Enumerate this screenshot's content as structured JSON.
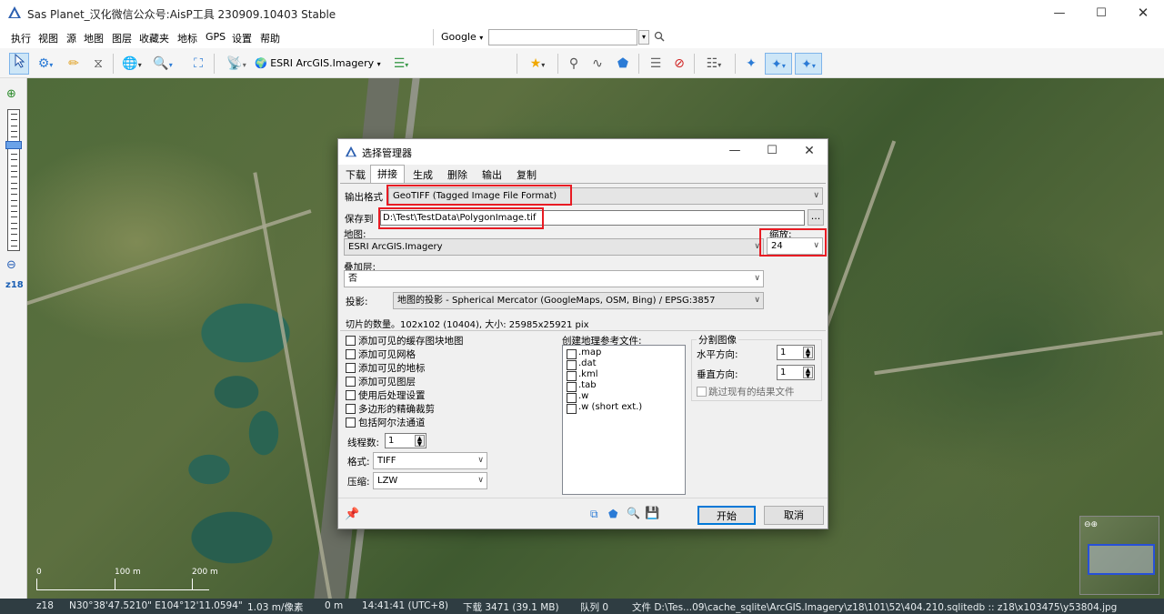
{
  "window": {
    "title": "Sas Planet_汉化微信公众号:AisP工具 230909.10403 Stable"
  },
  "menu": [
    "执行",
    "视图",
    "源",
    "地图",
    "图层",
    "收藏夹",
    "地标",
    "GPS",
    "设置",
    "帮助"
  ],
  "search": {
    "engine": "Google",
    "engine_arrow": "▾",
    "query": ""
  },
  "toolbar": {
    "map_source": "ESRI ArcGIS.Imagery"
  },
  "zoom_label": "z18",
  "scale": {
    "t0": "0",
    "t1": "100 m",
    "t2": "200 m"
  },
  "dialog": {
    "title": "选择管理器",
    "tabs": [
      "下载",
      "拼接",
      "生成",
      "删除",
      "输出",
      "复制"
    ],
    "active_tab": "拼接",
    "output_format_label": "输出格式",
    "output_format": "GeoTIFF (Tagged Image File Format)",
    "save_to_label": "保存到",
    "save_path": "D:\\Test\\TestData\\PolygonImage.tif",
    "browse": "...",
    "map_label": "地图:",
    "map_value": "ESRI ArcGIS.Imagery",
    "zoom_label": "缩放:",
    "zoom_value": "24",
    "layer_label": "叠加层:",
    "layer_value": "否",
    "projection_label": "投影:",
    "projection_value": "地图的投影 - Spherical Mercator (GoogleMaps, OSM, Bing) / EPSG:3857",
    "tile_count": "切片的数量。102x102 (10404), 大小: 25985x25921 pix",
    "options": [
      "添加可见的缓存图块地图",
      "添加可见网格",
      "添加可见的地标",
      "添加可见图层",
      "使用后处理设置",
      "多边形的精确裁剪",
      "包括阿尔法通道"
    ],
    "threads_label": "线程数:",
    "threads": "1",
    "format_label": "格式:",
    "format": "TIFF",
    "compress_label": "压缩:",
    "compress": "LZW",
    "georef_label": "创建地理参考文件:",
    "georef": [
      ".map",
      ".dat",
      ".kml",
      ".tab",
      ".w",
      ".w (short ext.)"
    ],
    "split_label": "分割图像",
    "horizontal_label": "水平方向:",
    "horizontal": "1",
    "vertical_label": "垂直方向:",
    "vertical": "1",
    "skip_label": "跳过现有的结果文件",
    "start": "开始",
    "cancel": "取消"
  },
  "status": {
    "zoom": "z18",
    "coords": "N30°38'47.5210\" E104°12'11.0594\"",
    "resolution": "1.03 m/像素",
    "dist": "0 m",
    "time": "14:41:41 (UTC+8)",
    "download": "下载 3471 (39.1 MB)",
    "queue": "队列 0",
    "file": "文件 D:\\Tes...09\\cache_sqlite\\ArcGIS.Imagery\\z18\\101\\52\\404.210.sqlitedb :: z18\\x103475\\y53804.jpg"
  }
}
